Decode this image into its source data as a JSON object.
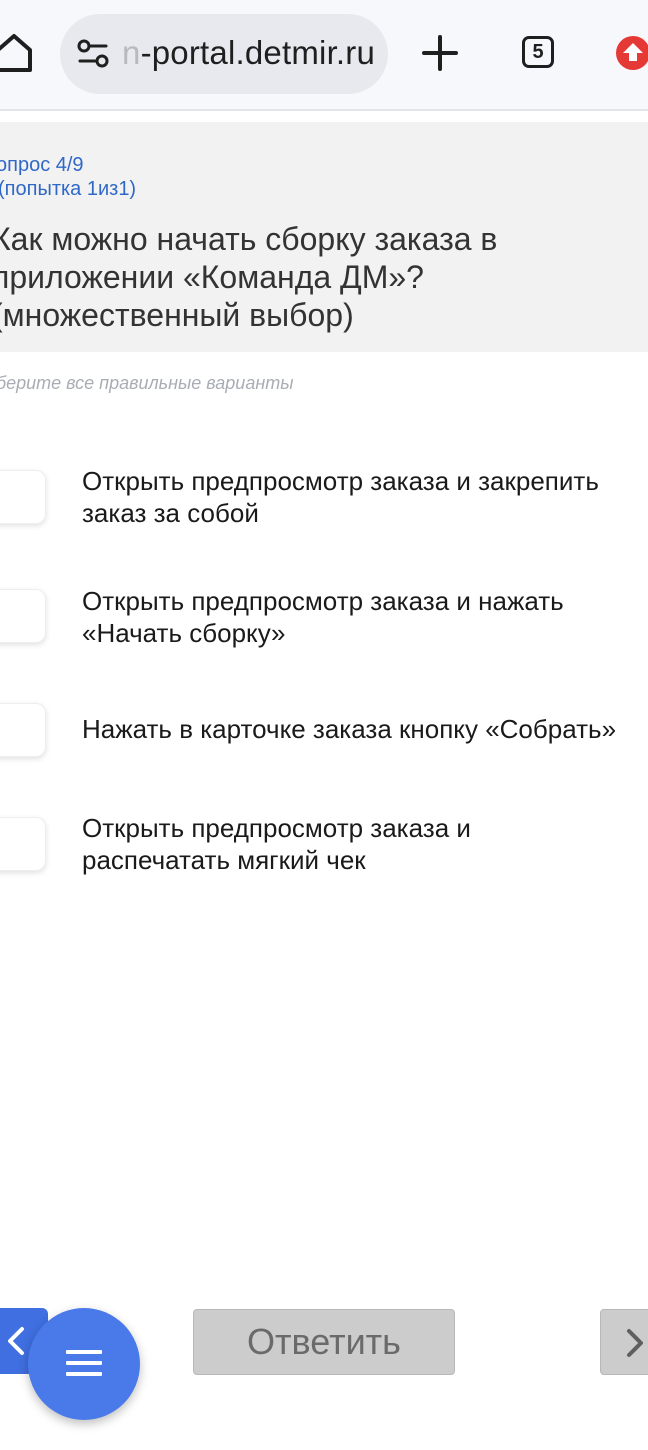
{
  "browser": {
    "url_prefix_faded": "n",
    "url_text": "-portal.detmir.ru",
    "tab_count": "5",
    "icons": {
      "home": "home-icon",
      "site_settings": "tune-icon",
      "new_tab": "plus-icon",
      "tabs": "tab-switcher-icon",
      "update": "update-arrow-icon"
    },
    "accent_update": "#e53935"
  },
  "question": {
    "number": "опрос 4/9",
    "attempt": "(попытка 1из1)",
    "text": "Как можно начать сборку заказа в приложении «Команда ДМ»? (множественный выбор)",
    "hint": "берите все правильные варианты"
  },
  "options": [
    {
      "label_line1": "Открыть предпросмотр заказа и закрепить",
      "label_line2": "заказ за собой",
      "checked": false
    },
    {
      "label_line1": "Открыть предпросмотр заказа и нажать",
      "label_line2": "«Начать сборку»",
      "checked": false
    },
    {
      "label_line1": "Нажать в карточке заказа кнопку «Собрать»",
      "label_line2": "",
      "checked": false
    },
    {
      "label_line1": "Открыть предпросмотр заказа и",
      "label_line2": "распечатать мягкий чек",
      "checked": false
    }
  ],
  "footer": {
    "answer_label": "Ответить",
    "prev_icon": "chevron-left-icon",
    "next_icon": "chevron-right-icon",
    "menu_icon": "hamburger-menu-icon",
    "accent": "#4a79ea"
  }
}
